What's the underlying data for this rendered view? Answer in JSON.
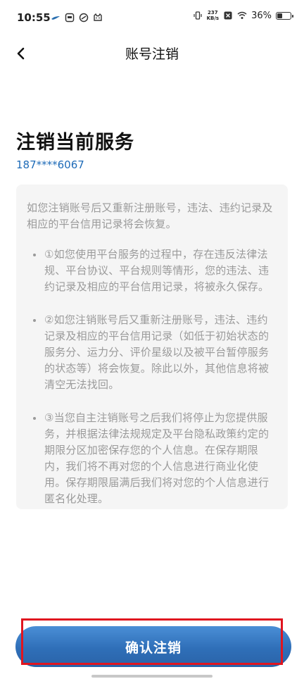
{
  "status_bar": {
    "time": "10:55",
    "net_speed_value": "237",
    "net_speed_unit": "KB/s",
    "battery_percent": "36%",
    "battery_level": 0.36,
    "icons": [
      "bird-icon",
      "app-icon",
      "link-icon",
      "cat-icon",
      "vibrate-icon",
      "x-icon",
      "wifi-icon",
      "battery-icon"
    ]
  },
  "header": {
    "title": "账号注销"
  },
  "section": {
    "title": "注销当前服务",
    "phone": "187****6067"
  },
  "info": {
    "intro": "如您注销账号后又重新注册账号，违法、违约记录及相应的平台信用记录将会恢复。",
    "items": [
      "①如您使用平台服务的过程中，存在违反法律法规、平台协议、平台规则等情形，您的违法、违约记录及相应的平台信用记录，将被永久保存。",
      "②如您注销账号后又重新注册账号，违法、违约记录及相应的平台信用记录（如低于初始状态的服务分、运力分、评价星级以及被平台暂停服务的状态等）将会恢复。除此以外，其他信息将被清空无法找回。",
      "③当您自主注销账号之后我们将停止为您提供服务，并根据法律法规规定及平台隐私政策约定的期限分区加密保存您的个人信息。在保存期限内，我们将不再对您的个人信息进行商业化使用。保存期限届满后我们将对您的个人信息进行匿名化处理。"
    ]
  },
  "footer": {
    "confirm_label": "确认注销"
  },
  "colors": {
    "accent": "#2f6fb8",
    "phone": "#1e6bb8",
    "highlight": "#e0151f"
  }
}
